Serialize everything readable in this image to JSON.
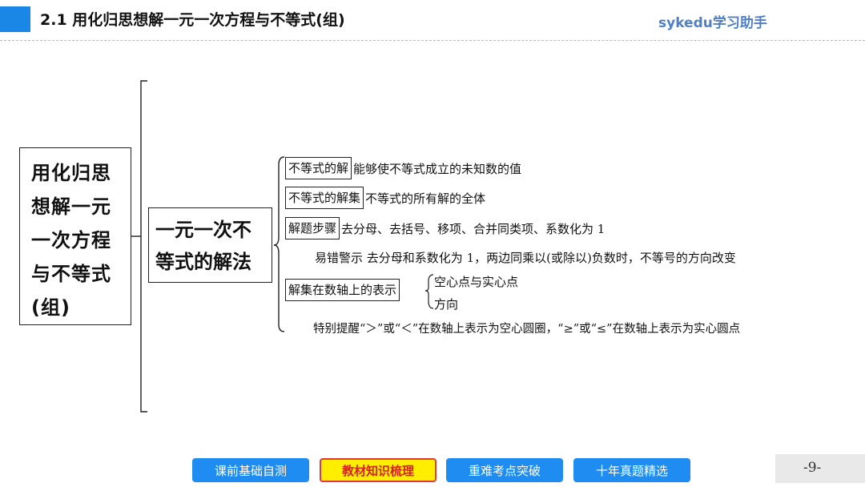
{
  "header": {
    "title": "2.1    用化归思想解一元一次方程与不等式(组)",
    "brand": "sykedu学习助手",
    "accent_color": "#1a86e6"
  },
  "main_topic": "用化归思想解一元一次方程与不等式(组)",
  "sub_topic": "一元一次不等式的解法",
  "items": {
    "solution": {
      "label": "不等式的解",
      "text": "能够使不等式成立的未知数的值"
    },
    "solution_set": {
      "label": "不等式的解集",
      "text": "不等式的所有解的全体"
    },
    "steps": {
      "label": "解题步骤",
      "text": "去分母、去括号、移项、合并同类项、系数化为 1"
    },
    "warning": {
      "label": "易错警示",
      "text": "去分母和系数化为 1，两边同乘以(或除以)负数时，不等号的方向改变"
    },
    "number_line": {
      "label": "解集在数轴上的表示",
      "sub_items": [
        "空心点与实心点",
        "方向"
      ]
    },
    "reminder": {
      "label": "特别提醒",
      "text": "“＞”或“＜”在数轴上表示为空心圆圈，“≥”或“≤”在数轴上表示为实心圆点"
    }
  },
  "nav": {
    "buttons": [
      "课前基础自测",
      "教材知识梳理",
      "重难考点突破",
      "十年真题精选"
    ],
    "active_index": 1,
    "active_color": "#ffee00",
    "button_color": "#1e8cf0"
  },
  "page_number": "-9-"
}
